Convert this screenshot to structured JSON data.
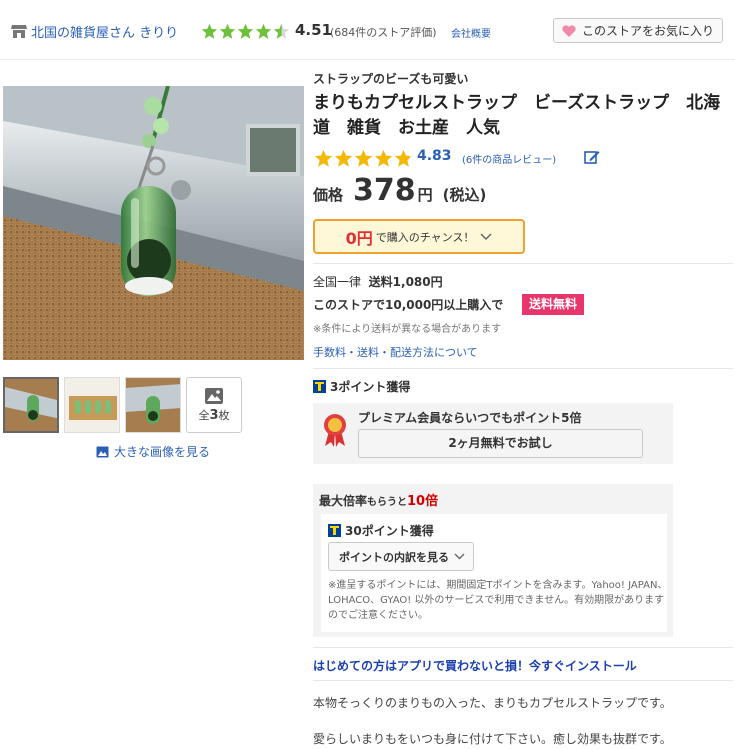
{
  "header": {
    "store_name": "北国の雑貨屋さん きりり",
    "rating_value": 4.51,
    "rating": "4.51",
    "rating_count": "(684件のストア評価)",
    "about": "会社概要",
    "favorite_button": "このストアをお気に入り"
  },
  "gallery": {
    "total_prefix": "全",
    "total_num": "3",
    "total_suffix": "枚",
    "big_image_link": "大きな画像を見る"
  },
  "product": {
    "catch_copy": "ストラップのビーズも可愛い",
    "title": "まりもカプセルストラップ　ビーズストラップ　北海道　雑貨　お土産　人気",
    "review_value": 4.83,
    "review_score": "4.83",
    "review_count": "(6件の商品レビュー)",
    "price_label": "価格",
    "price": "378",
    "price_unit": "円",
    "price_tax": "(税込)",
    "chance_amount": "0円",
    "chance_text": "で購入のチャンス！"
  },
  "shipping": {
    "line1_prefix": "全国一律",
    "line1_fee": "送料1,080円",
    "line2": "このストアで10,000円以上購入で",
    "free_badge": "送料無料",
    "note": "※条件により送料が異なる場合があります",
    "link": "手数料・送料・配送方法について"
  },
  "points": {
    "earned": "3ポイント獲得",
    "premium_text": "プレミアム会員ならいつでもポイント5倍",
    "trial_button": "2ヶ月無料でお試し",
    "max_label": "最大倍率",
    "max_small": "もらうと",
    "max_rate": "10倍",
    "max_points": "30ポイント獲得",
    "breakdown_button": "ポイントの内訳を見る",
    "note": "※進呈するポイントには、期間固定Tポイントを含みます。Yahoo! JAPAN、LOHACO、GYAO! 以外のサービスで利用できません。有効期限がありますのでご注意ください。"
  },
  "app_link": "はじめての方はアプリで買わないと損！今すぐインストール",
  "description": {
    "line1": "本物そっくりのまりもの入った、まりもカプセルストラップです。",
    "line2": "愛らしいまりもをいつも身に付けて下さい。癒し効果も抜群です。"
  },
  "colors": {
    "link": "#2a5fb8",
    "star": "#6ec23a",
    "review_star": "#f5b800",
    "free_badge": "#e8356b",
    "chance_border": "#f0a030"
  }
}
